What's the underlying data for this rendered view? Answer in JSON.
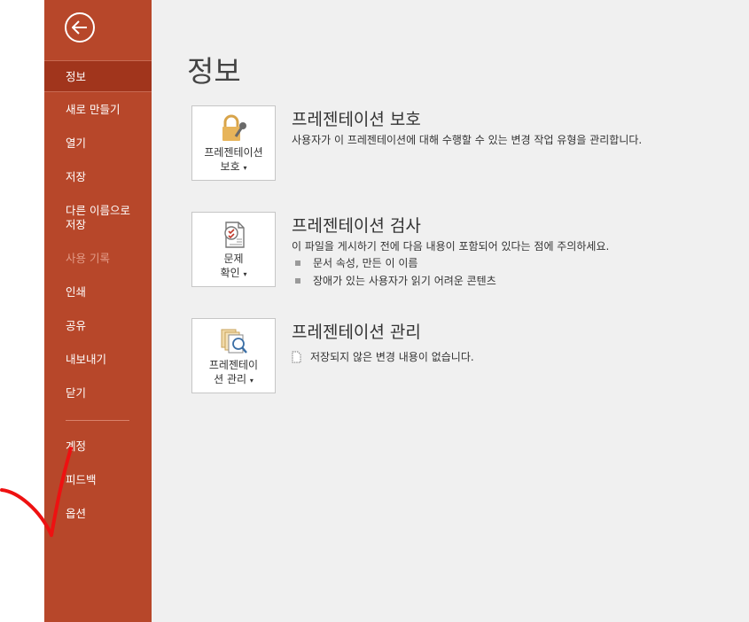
{
  "sidebar": {
    "items": [
      {
        "label": "정보",
        "selected": true
      },
      {
        "label": "새로 만들기"
      },
      {
        "label": "열기"
      },
      {
        "label": "저장"
      },
      {
        "label": "다른 이름으로\n저장"
      },
      {
        "label": "사용 기록",
        "disabled": true
      },
      {
        "label": "인쇄"
      },
      {
        "label": "공유"
      },
      {
        "label": "내보내기"
      },
      {
        "label": "닫기"
      },
      {
        "label": "계정"
      },
      {
        "label": "피드백"
      },
      {
        "label": "옵션"
      }
    ],
    "color": "#b7472a"
  },
  "page": {
    "title": "정보"
  },
  "sections": [
    {
      "button_line1": "프레젠테이션",
      "button_line2": "보호",
      "title": "프레젠테이션 보호",
      "desc": "사용자가 이 프레젠테이션에 대해 수행할 수 있는 변경 작업 유형을 관리합니다."
    },
    {
      "button_line1": "문제",
      "button_line2": "확인",
      "title": "프레젠테이션 검사",
      "desc": "이 파일을 게시하기 전에 다음 내용이 포함되어 있다는 점에 주의하세요.",
      "bullets": [
        "문서 속성, 만든 이 이름",
        "장애가 있는 사용자가 읽기 어려운 콘텐츠"
      ]
    },
    {
      "button_line1": "프레젠테이",
      "button_line2": "션 관리",
      "title": "프레젠테이션 관리",
      "desc": "저장되지 않은 변경 내용이 없습니다."
    }
  ]
}
